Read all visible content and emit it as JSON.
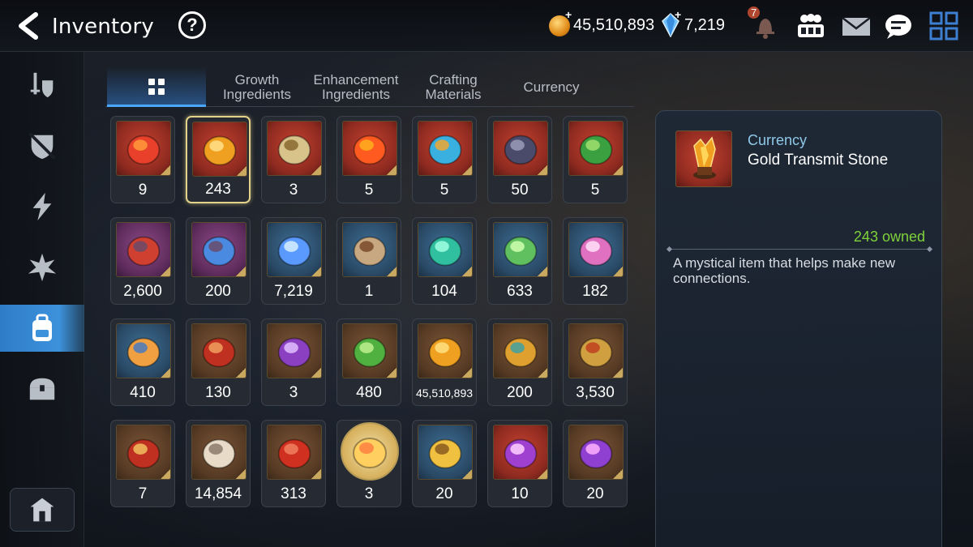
{
  "header": {
    "title": "Inventory",
    "help_label": "?",
    "gold": "45,510,893",
    "gems": "7,219",
    "bell_badge": "7"
  },
  "sidebar": {
    "items": [
      {
        "icon": "sword-shield-icon"
      },
      {
        "icon": "broken-shield-icon"
      },
      {
        "icon": "lightning-icon"
      },
      {
        "icon": "burst-icon"
      },
      {
        "icon": "backpack-icon",
        "active": true
      },
      {
        "icon": "chest-icon"
      }
    ],
    "bottom_icon": "house-icon"
  },
  "tabs": [
    {
      "label": "",
      "icon": "grid-icon",
      "active": true
    },
    {
      "label": "Growth\nIngredients"
    },
    {
      "label": "Enhancement\nIngredients"
    },
    {
      "label": "Crafting\nMaterials"
    },
    {
      "label": "Currency"
    }
  ],
  "items": [
    {
      "qty": "9",
      "frame": "red",
      "icon": "red-rune"
    },
    {
      "qty": "243",
      "frame": "red",
      "icon": "gold-transmit-stone",
      "selected": true
    },
    {
      "qty": "3",
      "frame": "red",
      "icon": "ticket"
    },
    {
      "qty": "5",
      "frame": "red",
      "icon": "flame-charm"
    },
    {
      "qty": "5",
      "frame": "red",
      "icon": "water-charm"
    },
    {
      "qty": "50",
      "frame": "red",
      "icon": "ring-charm"
    },
    {
      "qty": "5",
      "frame": "red",
      "icon": "clover-charm"
    },
    {
      "qty": "2,600",
      "frame": "purple",
      "icon": "red-flower-moon"
    },
    {
      "qty": "200",
      "frame": "purple",
      "icon": "blue-flower-moon"
    },
    {
      "qty": "7,219",
      "frame": "blue",
      "icon": "crystal"
    },
    {
      "qty": "1",
      "frame": "blue",
      "icon": "pendant"
    },
    {
      "qty": "104",
      "frame": "blue",
      "icon": "green-crystal"
    },
    {
      "qty": "633",
      "frame": "blue",
      "icon": "leaf"
    },
    {
      "qty": "182",
      "frame": "blue",
      "icon": "pink-mountain"
    },
    {
      "qty": "410",
      "frame": "blue",
      "icon": "star-compass"
    },
    {
      "qty": "130",
      "frame": "brown",
      "icon": "red-bracelet"
    },
    {
      "qty": "3",
      "frame": "brown",
      "icon": "purple-seal"
    },
    {
      "qty": "480",
      "frame": "brown",
      "icon": "green-heart"
    },
    {
      "qty": "45,510,893",
      "frame": "brown",
      "icon": "gold-coin",
      "small": true
    },
    {
      "qty": "200",
      "frame": "brown",
      "icon": "gold-emblem"
    },
    {
      "qty": "3,530",
      "frame": "brown",
      "icon": "fist-emblem"
    },
    {
      "qty": "7",
      "frame": "brown",
      "icon": "red-banner"
    },
    {
      "qty": "14,854",
      "frame": "brown",
      "icon": "chess-knight"
    },
    {
      "qty": "313",
      "frame": "brown",
      "icon": "red-leaf-shield"
    },
    {
      "qty": "3",
      "frame": "round",
      "icon": "chick-portrait"
    },
    {
      "qty": "20",
      "frame": "blue",
      "icon": "gold-flower"
    },
    {
      "qty": "10",
      "frame": "red",
      "icon": "purple-moon-gem"
    },
    {
      "qty": "20",
      "frame": "brown",
      "icon": "purple-triangle-moon"
    }
  ],
  "detail": {
    "category": "Currency",
    "name": "Gold Transmit Stone",
    "owned": "243 owned",
    "description": "A mystical item that helps make new connections."
  },
  "colors": {
    "accent": "#3d92dc",
    "owned_green": "#7fd13a",
    "category_blue": "#8fc9e8",
    "selected_border": "#e2d28a"
  }
}
